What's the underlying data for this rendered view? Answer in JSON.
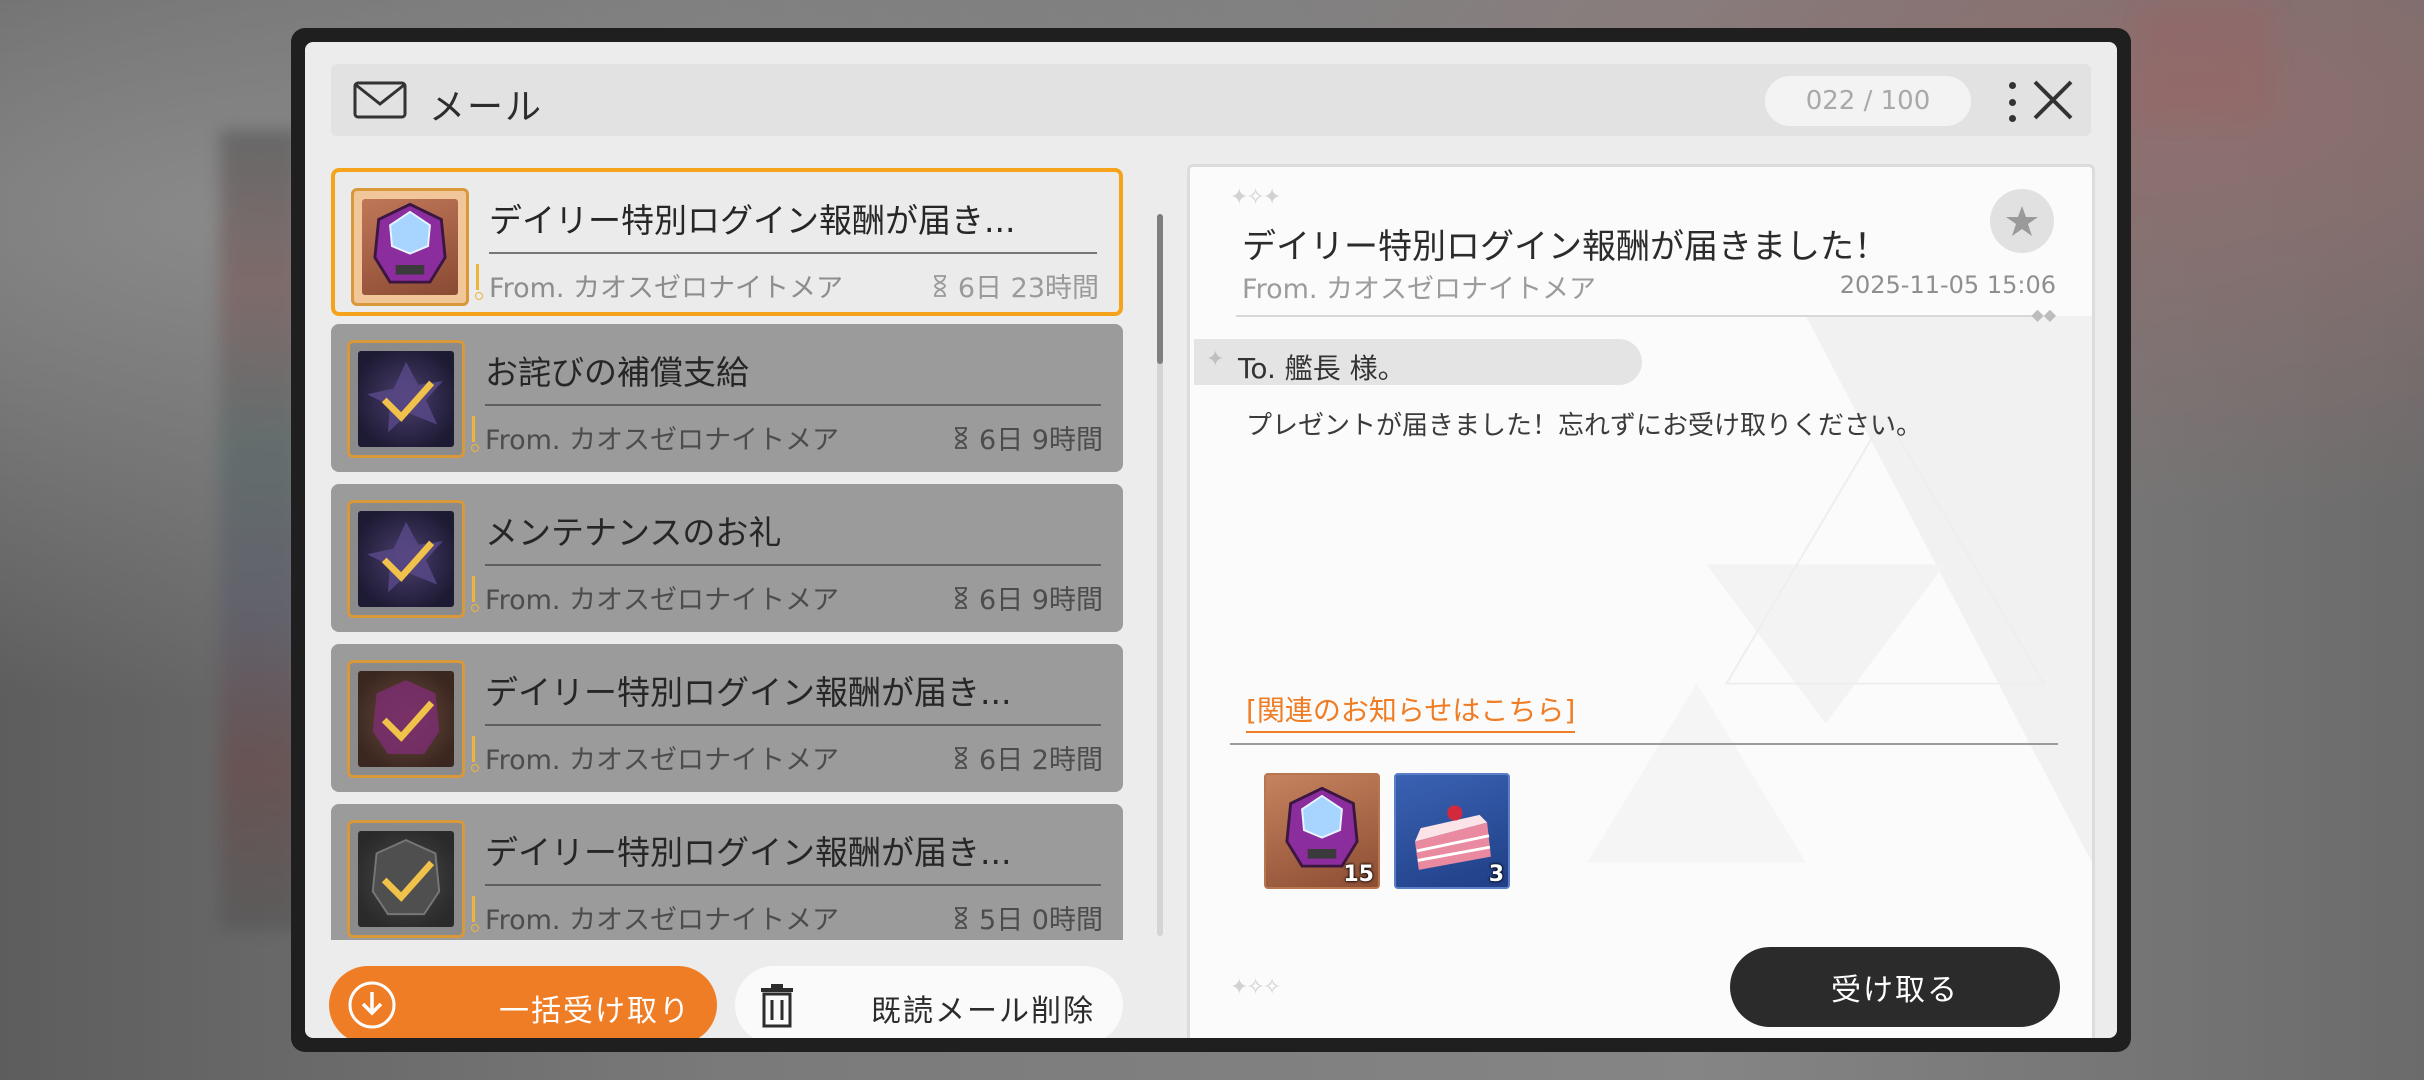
{
  "header": {
    "title": "メール",
    "counter": "022 / 100"
  },
  "mail_list": [
    {
      "title": "デイリー特別ログイン報酬が届き...",
      "from": "From. カオスゼロナイトメア",
      "remaining": "6日 23時間",
      "icon": "gem-chest-icon",
      "selected": true
    },
    {
      "title": "お詫びの補償支給",
      "from": "From. カオスゼロナイトメア",
      "remaining": "6日 9時間",
      "icon": "claimed-check-icon",
      "selected": false
    },
    {
      "title": "メンテナンスのお礼",
      "from": "From. カオスゼロナイトメア",
      "remaining": "6日 9時間",
      "icon": "claimed-check-icon",
      "selected": false
    },
    {
      "title": "デイリー特別ログイン報酬が届き...",
      "from": "From. カオスゼロナイトメア",
      "remaining": "6日 2時間",
      "icon": "claimed-check-icon",
      "selected": false
    },
    {
      "title": "デイリー特別ログイン報酬が届き...",
      "from": "From. カオスゼロナイトメア",
      "remaining": "5日 0時間",
      "icon": "claimed-check-icon",
      "selected": false
    }
  ],
  "actions": {
    "claim_all": "一括受け取り",
    "delete_read": "既読メール削除"
  },
  "detail": {
    "title": "デイリー特別ログイン報酬が届きました！",
    "from": "From. カオスゼロナイトメア",
    "date": "2025-11-05 15:06",
    "to": "To. 艦長 様。",
    "body": "プレゼントが届きました！忘れずにお受け取りください。",
    "link": "[関連のお知らせはこちら]",
    "rewards": [
      {
        "icon": "gem-chest-icon",
        "quantity": "15"
      },
      {
        "icon": "cake-icon",
        "quantity": "3"
      }
    ],
    "receive_button": "受け取る"
  },
  "colors": {
    "accent_orange": "#ef7d26",
    "selected_border": "#f5a31a",
    "dark_button": "#2b2b2b"
  }
}
